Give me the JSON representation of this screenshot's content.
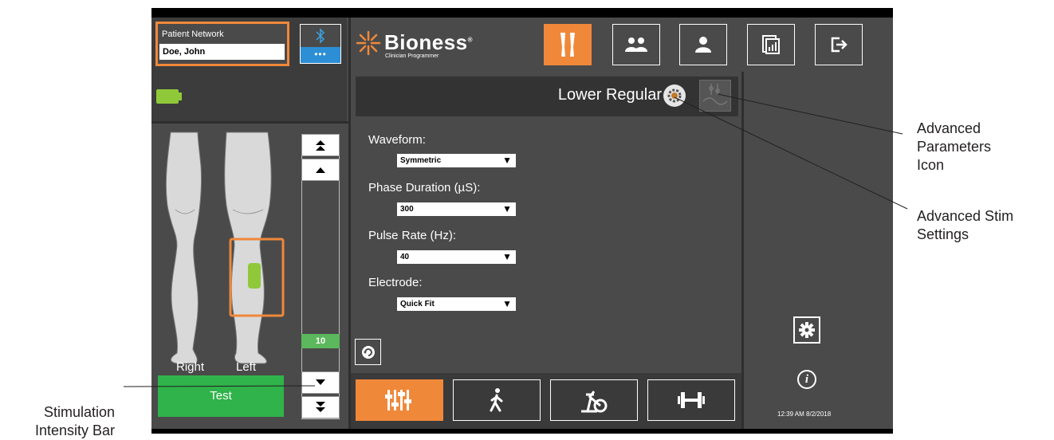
{
  "patient": {
    "network_label": "Patient Network",
    "name": "Doe, John"
  },
  "bluetooth": {
    "icon": "bluetooth-icon",
    "dots": "•••"
  },
  "colors": {
    "accent": "#f0883a",
    "battery": "#8fc93a",
    "test": "#2fb34a",
    "bluetooth": "#2c8fd6",
    "intensity_value_bg": "#5cb85c"
  },
  "brand": {
    "name": "Bioness",
    "mark": "®",
    "subtitle": "Clinician Programmer"
  },
  "toolbar": {
    "items": [
      "legs-icon",
      "group-icon",
      "person-icon",
      "report-icon",
      "exit-icon"
    ]
  },
  "legs": {
    "right_label": "Right",
    "left_label": "Left"
  },
  "intensity": {
    "value": "10"
  },
  "test_label": "Test",
  "program": {
    "title": "Lower Regular",
    "fields": [
      {
        "label": "Waveform:",
        "value": "Symmetric"
      },
      {
        "label": "Phase Duration (µS):",
        "value": "300"
      },
      {
        "label": "Pulse Rate (Hz):",
        "value": "40"
      },
      {
        "label": "Electrode:",
        "value": "Quick Fit"
      }
    ]
  },
  "bottom_tabs": [
    "sliders-icon",
    "walking-icon",
    "bike-icon",
    "dumbbell-icon"
  ],
  "status": {
    "timestamp": "12:39 AM 8/2/2018"
  },
  "annotations": {
    "advanced_parameters": [
      "Advanced",
      "Parameters",
      "Icon"
    ],
    "advanced_stim": [
      "Advanced Stim",
      "Settings"
    ],
    "stim_intensity": [
      "Stimulation",
      "Intensity Bar"
    ]
  }
}
